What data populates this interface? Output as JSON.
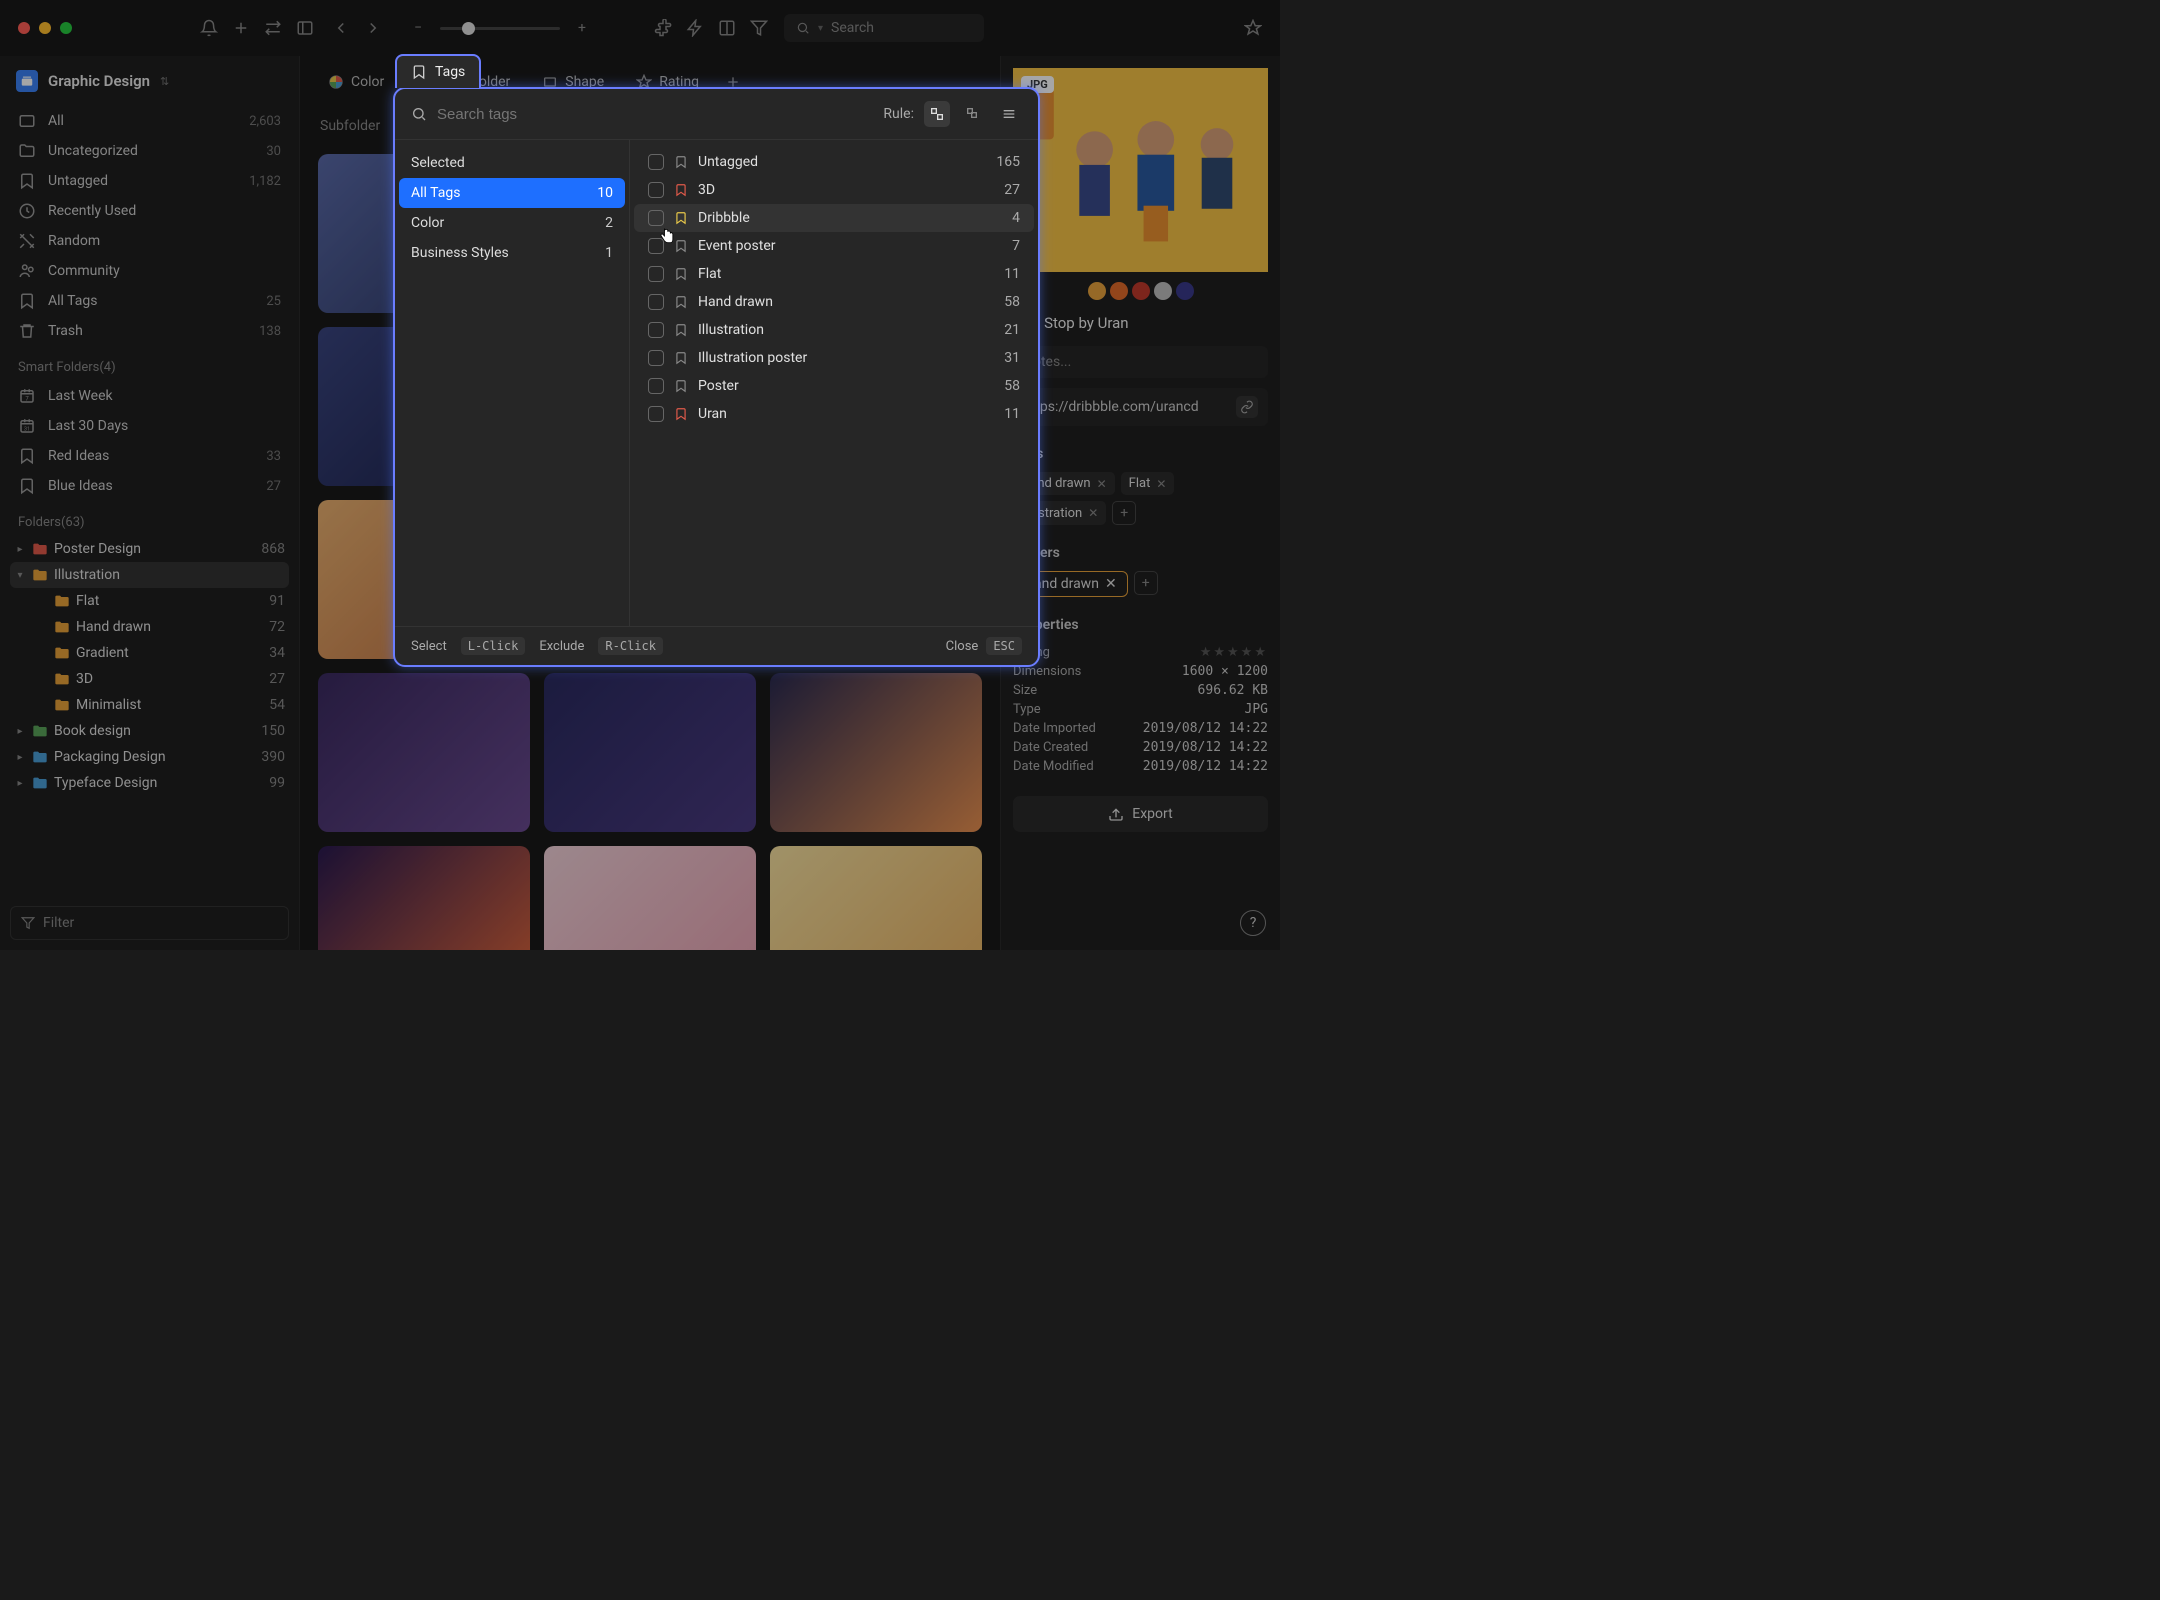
{
  "library": {
    "name": "Graphic Design"
  },
  "search": {
    "placeholder": "Search"
  },
  "sidebar": {
    "items": [
      {
        "label": "All",
        "count": "2,603"
      },
      {
        "label": "Uncategorized",
        "count": "30"
      },
      {
        "label": "Untagged",
        "count": "1,182"
      },
      {
        "label": "Recently Used",
        "count": ""
      },
      {
        "label": "Random",
        "count": ""
      },
      {
        "label": "Community",
        "count": ""
      },
      {
        "label": "All Tags",
        "count": "25"
      },
      {
        "label": "Trash",
        "count": "138"
      }
    ],
    "smart_header": "Smart Folders(4)",
    "smart": [
      {
        "label": "Last Week",
        "count": ""
      },
      {
        "label": "Last 30 Days",
        "count": ""
      },
      {
        "label": "Red Ideas",
        "count": "33"
      },
      {
        "label": "Blue Ideas",
        "count": "27"
      }
    ],
    "folders_header": "Folders(63)",
    "folders": [
      {
        "label": "Poster Design",
        "count": "868",
        "color": "#e05a4a"
      },
      {
        "label": "Illustration",
        "count": "",
        "color": "#e8a13a",
        "selected": true
      },
      {
        "label": "Book design",
        "count": "150",
        "color": "#5aa35a"
      },
      {
        "label": "Packaging Design",
        "count": "390",
        "color": "#4a9fd8"
      },
      {
        "label": "Typeface Design",
        "count": "99",
        "color": "#4a9fd8"
      }
    ],
    "subfolders": [
      {
        "label": "Flat",
        "count": "91"
      },
      {
        "label": "Hand drawn",
        "count": "72"
      },
      {
        "label": "Gradient",
        "count": "34"
      },
      {
        "label": "3D",
        "count": "27"
      },
      {
        "label": "Minimalist",
        "count": "54"
      }
    ],
    "filter_placeholder": "Filter"
  },
  "filters": {
    "chips": [
      {
        "label": "Color"
      },
      {
        "label": "Tags",
        "active": true
      },
      {
        "label": "Folder"
      },
      {
        "label": "Shape"
      },
      {
        "label": "Rating"
      }
    ],
    "subfolder_label": "Subfolder"
  },
  "popup": {
    "tab_label": "Tags",
    "search_placeholder": "Search tags",
    "rule_label": "Rule:",
    "groups": [
      {
        "label": "Selected",
        "count": ""
      },
      {
        "label": "All Tags",
        "count": "10",
        "selected": true
      },
      {
        "label": "Color",
        "count": "2"
      },
      {
        "label": "Business Styles",
        "count": "1"
      }
    ],
    "tags": [
      {
        "label": "Untagged",
        "count": "165",
        "color": "#888"
      },
      {
        "label": "3D",
        "count": "27",
        "color": "#e05a4a"
      },
      {
        "label": "Dribbble",
        "count": "4",
        "color": "#e8c84a",
        "hover": true
      },
      {
        "label": "Event poster",
        "count": "7",
        "color": "#888"
      },
      {
        "label": "Flat",
        "count": "11",
        "color": "#888"
      },
      {
        "label": "Hand drawn",
        "count": "58",
        "color": "#888"
      },
      {
        "label": "Illustration",
        "count": "21",
        "color": "#888"
      },
      {
        "label": "Illustration poster",
        "count": "31",
        "color": "#888"
      },
      {
        "label": "Poster",
        "count": "58",
        "color": "#888"
      },
      {
        "label": "Uran",
        "count": "11",
        "color": "#e05a4a"
      }
    ],
    "footer": {
      "select": "Select",
      "select_key": "L-Click",
      "exclude": "Exclude",
      "exclude_key": "R-Click",
      "close": "Close",
      "close_key": "ESC"
    }
  },
  "inspector": {
    "format": "JPG",
    "swatches": [
      "#e6a23c",
      "#e06a2a",
      "#c0392b",
      "#bdbdbd",
      "#3a3a8a"
    ],
    "name": "Bus Stop by Uran",
    "notes_placeholder": "Notes...",
    "url": "https://dribbble.com/urancd",
    "tags_header": "Tags",
    "tags": [
      "Hand drawn",
      "Flat",
      "Illustration"
    ],
    "folders_header": "Folders",
    "folders": [
      "Hand drawn"
    ],
    "properties_header": "Properties",
    "properties": [
      {
        "k": "Rating",
        "v": "★★★★★"
      },
      {
        "k": "Dimensions",
        "v": "1600 × 1200"
      },
      {
        "k": "Size",
        "v": "696.62 KB"
      },
      {
        "k": "Type",
        "v": "JPG"
      },
      {
        "k": "Date Imported",
        "v": "2019/08/12 14:22"
      },
      {
        "k": "Date Created",
        "v": "2019/08/12 14:22"
      },
      {
        "k": "Date Modified",
        "v": "2019/08/12 14:22"
      }
    ],
    "export_label": "Export"
  }
}
